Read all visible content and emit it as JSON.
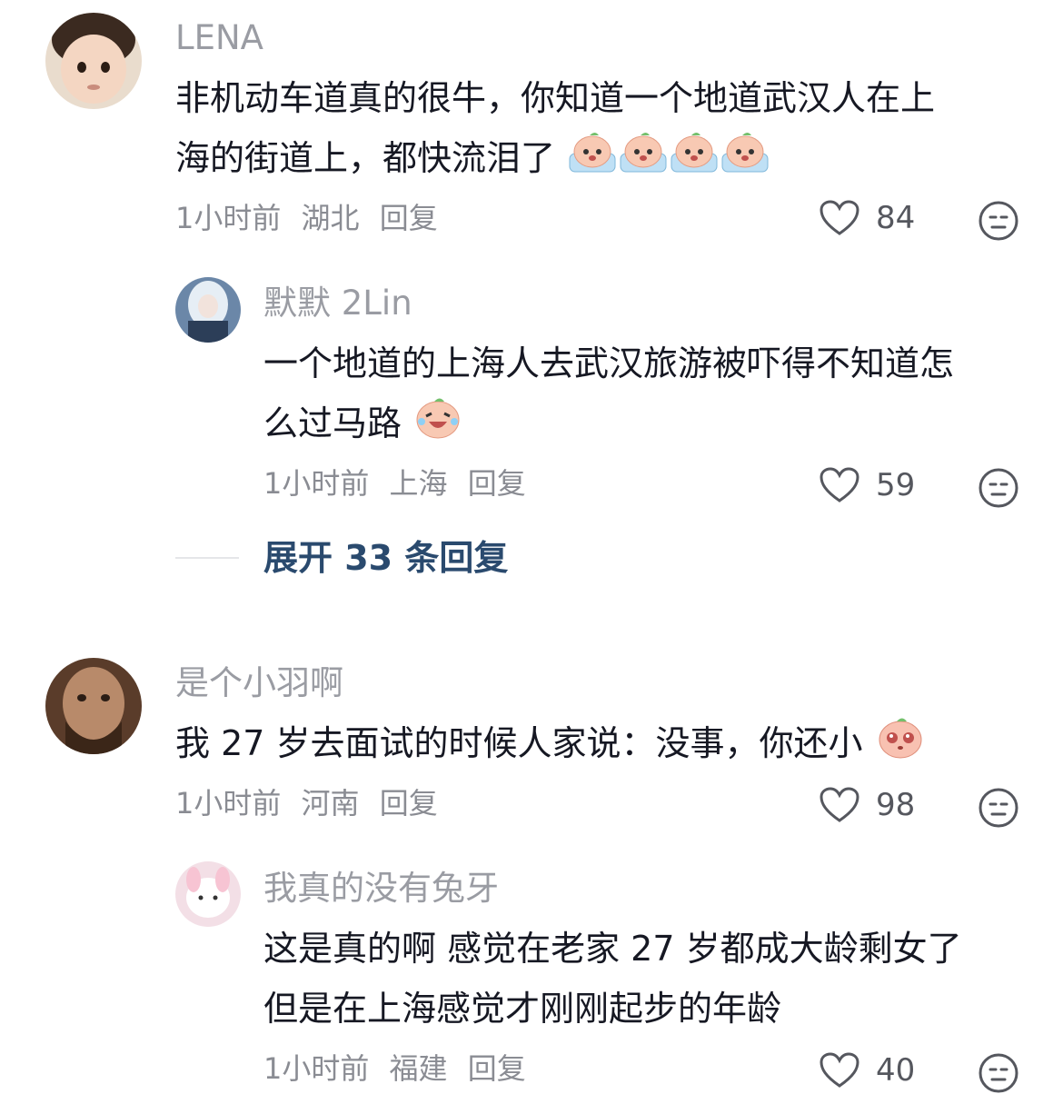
{
  "comments": [
    {
      "user": "LENA",
      "line1": "非机动车道真的很牛，你知道一个地道武汉人在上",
      "line2": "海的街道上，都快流泪了",
      "time": "1小时前",
      "location": "湖北",
      "reply": "回复",
      "likes": "84",
      "icons": [
        "crying-peach-emoji",
        "like-heart-icon",
        "dislike-face-icon"
      ]
    },
    {
      "user": "默默 2Lin",
      "line1": "一个地道的上海人去武汉旅游被吓得不知道怎",
      "line2": "么过马路",
      "time": "1小时前",
      "location": "上海",
      "reply": "回复",
      "likes": "59"
    },
    {
      "user": "是个小羽啊",
      "line1_a": "我 27",
      "line1_b": "岁去面试的时候人家说：没事，你还小",
      "time": "1小时前",
      "location": "河南",
      "reply": "回复",
      "likes": "98"
    },
    {
      "user": "我真的没有兔牙",
      "line1": "这是真的啊 感觉在老家 27 岁都成大龄剩女了",
      "line2": "但是在上海感觉才刚刚起步的年龄",
      "time": "1小时前",
      "location": "福建",
      "reply": "回复",
      "likes": "40"
    }
  ],
  "expand_label": "展开 33 条回复",
  "colors": {
    "link": "#2a4a6e",
    "meta": "#8a8c93",
    "name": "#9a9ca3",
    "text": "#161823"
  }
}
